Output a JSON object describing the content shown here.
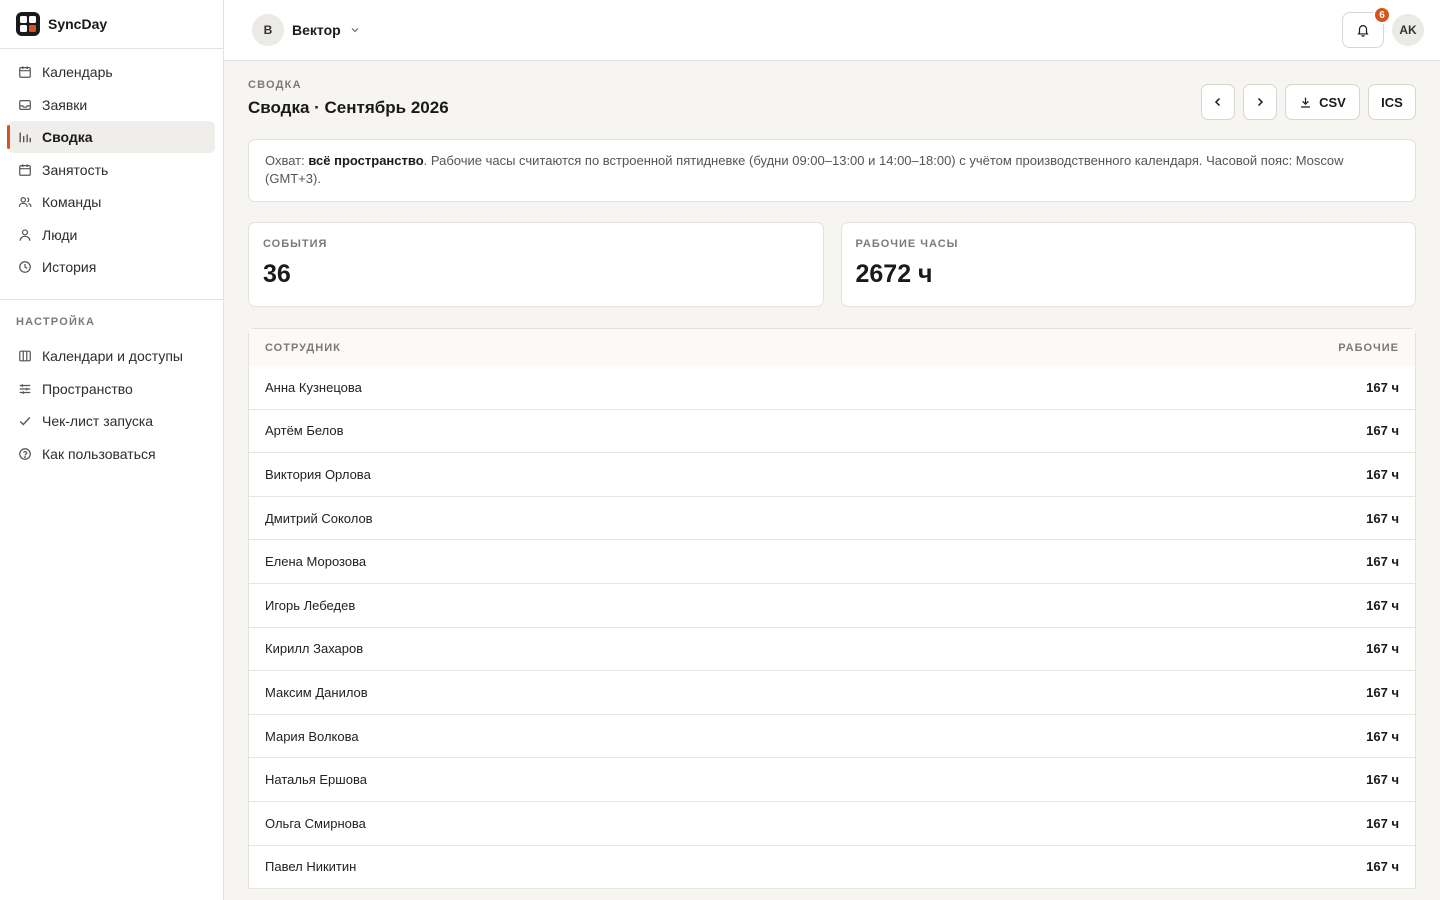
{
  "brand": {
    "name": "SyncDay"
  },
  "nav": {
    "items": [
      {
        "label": "Календарь",
        "icon": "calendar-icon"
      },
      {
        "label": "Заявки",
        "icon": "inbox-icon"
      },
      {
        "label": "Сводка",
        "icon": "bar-chart-icon",
        "active": true
      },
      {
        "label": "Занятость",
        "icon": "calendar-icon"
      },
      {
        "label": "Команды",
        "icon": "users-icon"
      },
      {
        "label": "Люди",
        "icon": "user-icon"
      },
      {
        "label": "История",
        "icon": "clock-icon"
      }
    ],
    "settings_title": "НАСТРОЙКА",
    "settings": [
      {
        "label": "Календари и доступы",
        "icon": "columns-icon"
      },
      {
        "label": "Пространство",
        "icon": "sliders-icon"
      },
      {
        "label": "Чек-лист запуска",
        "icon": "check-icon"
      },
      {
        "label": "Как пользоваться",
        "icon": "help-circle-icon"
      }
    ]
  },
  "topbar": {
    "workspace_initial": "В",
    "workspace_name": "Вектор",
    "notifications_count": "6",
    "user_initials": "AK"
  },
  "page": {
    "eyebrow": "СВОДКА",
    "title": "Сводка · Сентябрь 2026",
    "csv_label": "CSV",
    "ics_label": "ICS"
  },
  "info": {
    "prefix": "Охват: ",
    "scope": "всё пространство",
    "rest": ". Рабочие часы считаются по встроенной пятидневке (будни 09:00–13:00 и 14:00–18:00) с учётом производственного календаря. Часовой пояс: Moscow (GMT+3)."
  },
  "stats": {
    "events_label": "СОБЫТИЯ",
    "events_value": "36",
    "hours_label": "РАБОЧИЕ ЧАСЫ",
    "hours_value": "2672 ч"
  },
  "table": {
    "col_employee": "СОТРУДНИК",
    "col_hours": "РАБОЧИЕ",
    "rows": [
      {
        "name": "Анна Кузнецова",
        "hours": "167 ч"
      },
      {
        "name": "Артём Белов",
        "hours": "167 ч"
      },
      {
        "name": "Виктория Орлова",
        "hours": "167 ч"
      },
      {
        "name": "Дмитрий Соколов",
        "hours": "167 ч"
      },
      {
        "name": "Елена Морозова",
        "hours": "167 ч"
      },
      {
        "name": "Игорь Лебедев",
        "hours": "167 ч"
      },
      {
        "name": "Кирилл Захаров",
        "hours": "167 ч"
      },
      {
        "name": "Максим Данилов",
        "hours": "167 ч"
      },
      {
        "name": "Мария Волкова",
        "hours": "167 ч"
      },
      {
        "name": "Наталья Ершова",
        "hours": "167 ч"
      },
      {
        "name": "Ольга Смирнова",
        "hours": "167 ч"
      },
      {
        "name": "Павел Никитин",
        "hours": "167 ч"
      }
    ]
  },
  "colors": {
    "accent": "#d4561e",
    "background": "#f6f5f2",
    "border": "#e4e2dd"
  }
}
